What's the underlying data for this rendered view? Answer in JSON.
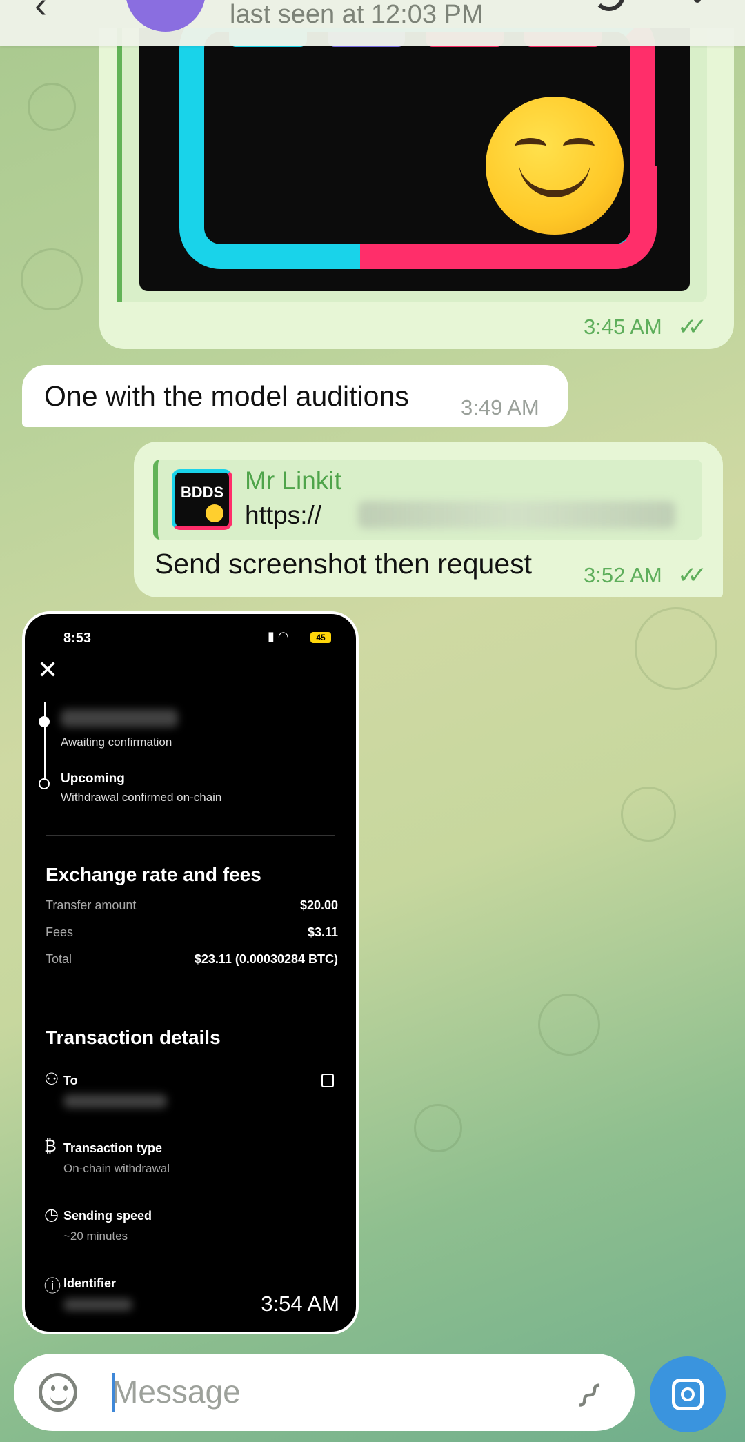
{
  "header": {
    "last_seen": "last seen at 12:03 PM"
  },
  "messages": {
    "image_preview_time": "3:45 AM",
    "incoming_text": "One with the model auditions",
    "incoming_time": "3:49 AM",
    "reply_quote_name": "Mr Linkit",
    "reply_quote_link": "https://",
    "reply_quote_thumb": "BDDS",
    "reply_text": "Send screenshot then request",
    "reply_time": "3:52 AM",
    "image_time": "3:54 AM"
  },
  "screenshot": {
    "status_time": "8:53",
    "battery": "45",
    "awaiting": "Awaiting confirmation",
    "upcoming": "Upcoming",
    "upcoming_sub": "Withdrawal confirmed on-chain",
    "fees_title": "Exchange rate and fees",
    "rows": [
      {
        "label": "Transfer amount",
        "value": "$20.00"
      },
      {
        "label": "Fees",
        "value": "$3.11"
      },
      {
        "label": "Total",
        "value": "$23.11 (0.00030284 BTC)"
      }
    ],
    "details_title": "Transaction details",
    "to_label": "To",
    "type_label": "Transaction type",
    "type_value": "On-chain withdrawal",
    "speed_label": "Sending speed",
    "speed_value": "~20 minutes",
    "identifier_label": "Identifier"
  },
  "input": {
    "placeholder": "Message"
  },
  "colors": {
    "outgoing_bubble": "#e7f6d6",
    "accent_green": "#5eae5b",
    "camera_button": "#3a94de"
  }
}
